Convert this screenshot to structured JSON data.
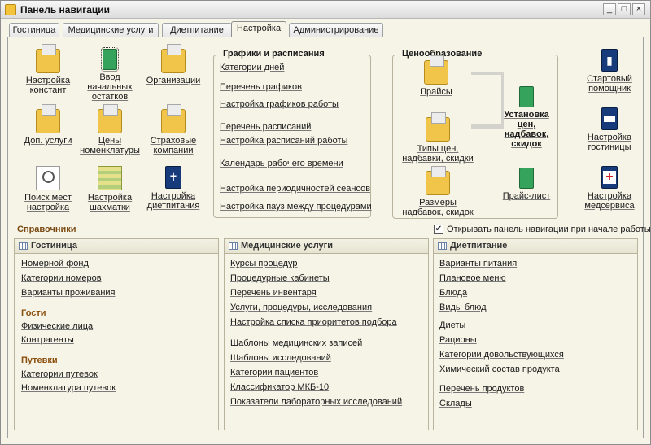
{
  "window": {
    "title": "Панель навигации",
    "minimize": "_",
    "maximize": "□",
    "close": "×"
  },
  "tabs": [
    "Гостиница",
    "Медицинские услуги",
    "Диетпитание",
    "Настройка",
    "Администрирование"
  ],
  "active_tab": "Настройка",
  "icons": {
    "nastroika_konstant": [
      "Настройка",
      "констант"
    ],
    "vvod_ostatkov": [
      "Ввод",
      "начальных",
      "остатков"
    ],
    "organizacii": [
      "Организации"
    ],
    "dop_uslugi": [
      "Доп. услуги"
    ],
    "ceny_nomenklatury": [
      "Цены",
      "номенклатуры"
    ],
    "strahovye": [
      "Страховые",
      "компании"
    ],
    "poisk_mest": [
      "Поиск мест",
      "настройка"
    ],
    "shahmatki": [
      "Настройка",
      "шахматки"
    ],
    "dietpitaniya": [
      "Настройка",
      "диетпитания"
    ],
    "startovyi": [
      "Стартовый",
      "помощник"
    ],
    "gostinicy": [
      "Настройка",
      "гостиницы"
    ],
    "medservisa": [
      "Настройка",
      "медсервиса"
    ]
  },
  "schedules": {
    "title": "Графики и расписания",
    "links": [
      "Категории дней",
      "Перечень графиков",
      "Настройка графиков работы",
      "Перечень расписаний",
      "Настройка расписаний работы",
      "Календарь рабочего времени",
      "Настройка периодичностей сеансов",
      "Настройка пауз между процедурами"
    ]
  },
  "pricing": {
    "title": "Ценообразование",
    "prices": [
      "Прайсы"
    ],
    "types": [
      "Типы цен,",
      "надбавки, скидки"
    ],
    "sizes": [
      "Размеры",
      "надбавок, скидок"
    ],
    "setup": [
      "Установка",
      "цен,",
      "надбавок,",
      "скидок"
    ],
    "pricelist": [
      "Прайс-лист"
    ]
  },
  "directories": {
    "title": "Справочники",
    "checkbox_label": "Открывать панель навигации при начале работы",
    "checkbox_checked": "✔",
    "hotel": {
      "title": "Гостиница",
      "links": [
        "Номерной фонд",
        "Категории номеров",
        "Варианты проживания"
      ],
      "guests_title": "Гости",
      "guests": [
        "Физические лица",
        "Контрагенты"
      ],
      "vouchers_title": "Путевки",
      "vouchers": [
        "Категории путевок",
        "Номенклатура путевок"
      ]
    },
    "medical": {
      "title": "Медицинские услуги",
      "links": [
        "Курсы процедур",
        "Процедурные кабинеты",
        "Перечень инвентаря",
        "Услуги, процедуры, исследования",
        "Настройка списка приоритетов подбора",
        "Шаблоны медицинских записей",
        "Шаблоны исследований",
        "Категории пациентов",
        "Классификатор МКБ-10",
        "Показатели лабораторных исследований"
      ]
    },
    "diet": {
      "title": "Диетпитание",
      "links": [
        "Варианты питания",
        "Плановое меню",
        "Блюда",
        "Виды блюд",
        "Диеты",
        "Рационы",
        "Категории довольствующихся",
        "Химический состав продукта",
        "Перечень продуктов",
        "Склады"
      ]
    }
  }
}
